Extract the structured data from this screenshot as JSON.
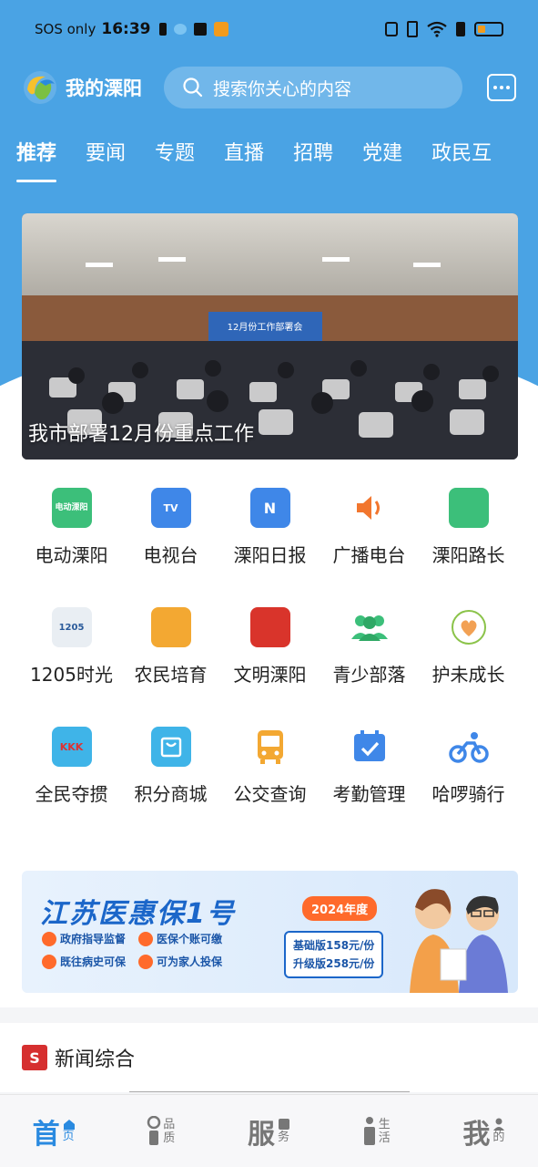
{
  "status_bar": {
    "carrier": "SOS only",
    "time": "16:39"
  },
  "header": {
    "app_name": "我的溧阳",
    "search_placeholder": "搜索你关心的内容"
  },
  "tabs": [
    "推荐",
    "要闻",
    "专题",
    "直播",
    "招聘",
    "党建",
    "政民互"
  ],
  "banner": {
    "caption": "我市部署12月份重点工作",
    "screen_text": "12月份工作部署会"
  },
  "services": [
    {
      "label": "电动溧阳",
      "icon": "dianli-icon",
      "icon_text": "电动溧阳",
      "color": "#3cbf7a"
    },
    {
      "label": "电视台",
      "icon": "tv-icon",
      "icon_text": "TV",
      "color": "#3f87e8"
    },
    {
      "label": "溧阳日报",
      "icon": "newspaper-icon",
      "icon_text": "N",
      "color": "#3f87e8"
    },
    {
      "label": "广播电台",
      "icon": "speaker-icon",
      "icon_text": "",
      "color": "#f2762e"
    },
    {
      "label": "溧阳路长",
      "icon": "road-icon",
      "icon_text": "",
      "color": "#3cbf7a"
    },
    {
      "label": "1205时光",
      "icon": "pencils-icon",
      "icon_text": "1205",
      "color": "#e9eef3"
    },
    {
      "label": "农民培育",
      "icon": "wheat-book-icon",
      "icon_text": "",
      "color": "#f3a832"
    },
    {
      "label": "文明溧阳",
      "icon": "civilization-icon",
      "icon_text": "",
      "color": "#d9342b"
    },
    {
      "label": "青少部落",
      "icon": "group-icon",
      "icon_text": "",
      "color": "#3cbf7a"
    },
    {
      "label": "护未成长",
      "icon": "heart-leaf-icon",
      "icon_text": "",
      "color": "#8bc34a"
    },
    {
      "label": "全民夺掼",
      "icon": "cards-icon",
      "icon_text": "KKK",
      "color": "#3fb4e8"
    },
    {
      "label": "积分商城",
      "icon": "shopping-bag-icon",
      "icon_text": "",
      "color": "#3fb4e8"
    },
    {
      "label": "公交查询",
      "icon": "bus-icon",
      "icon_text": "",
      "color": "#f3a832"
    },
    {
      "label": "考勤管理",
      "icon": "calendar-check-icon",
      "icon_text": "",
      "color": "#3f87e8"
    },
    {
      "label": "哈啰骑行",
      "icon": "bike-icon",
      "icon_text": "",
      "color": "#3f87e8"
    }
  ],
  "ad": {
    "title": "江苏医惠保1号",
    "year": "2024年度",
    "tags": [
      "政府指导监督",
      "医保个账可缴",
      "既往病史可保",
      "可为家人投保"
    ],
    "prices": [
      "基础版158元/份",
      "升级版258元/份"
    ]
  },
  "news_section": {
    "label": "新闻综合"
  },
  "bottom_nav": [
    {
      "big": "首",
      "small": [
        "页"
      ],
      "active": true,
      "icon": "home-icon"
    },
    {
      "big": "",
      "small": [
        "品",
        "质"
      ],
      "active": false,
      "icon": "pin-icon"
    },
    {
      "big": "服",
      "small": [
        "务"
      ],
      "active": false,
      "icon": "service-icon"
    },
    {
      "big": "",
      "small": [
        "生",
        "活"
      ],
      "active": false,
      "icon": "info-icon"
    },
    {
      "big": "我",
      "small": [
        "的"
      ],
      "active": false,
      "icon": "user-icon"
    }
  ],
  "colors": {
    "primary": "#4aa3e4",
    "accent": "#2a8ae0"
  }
}
